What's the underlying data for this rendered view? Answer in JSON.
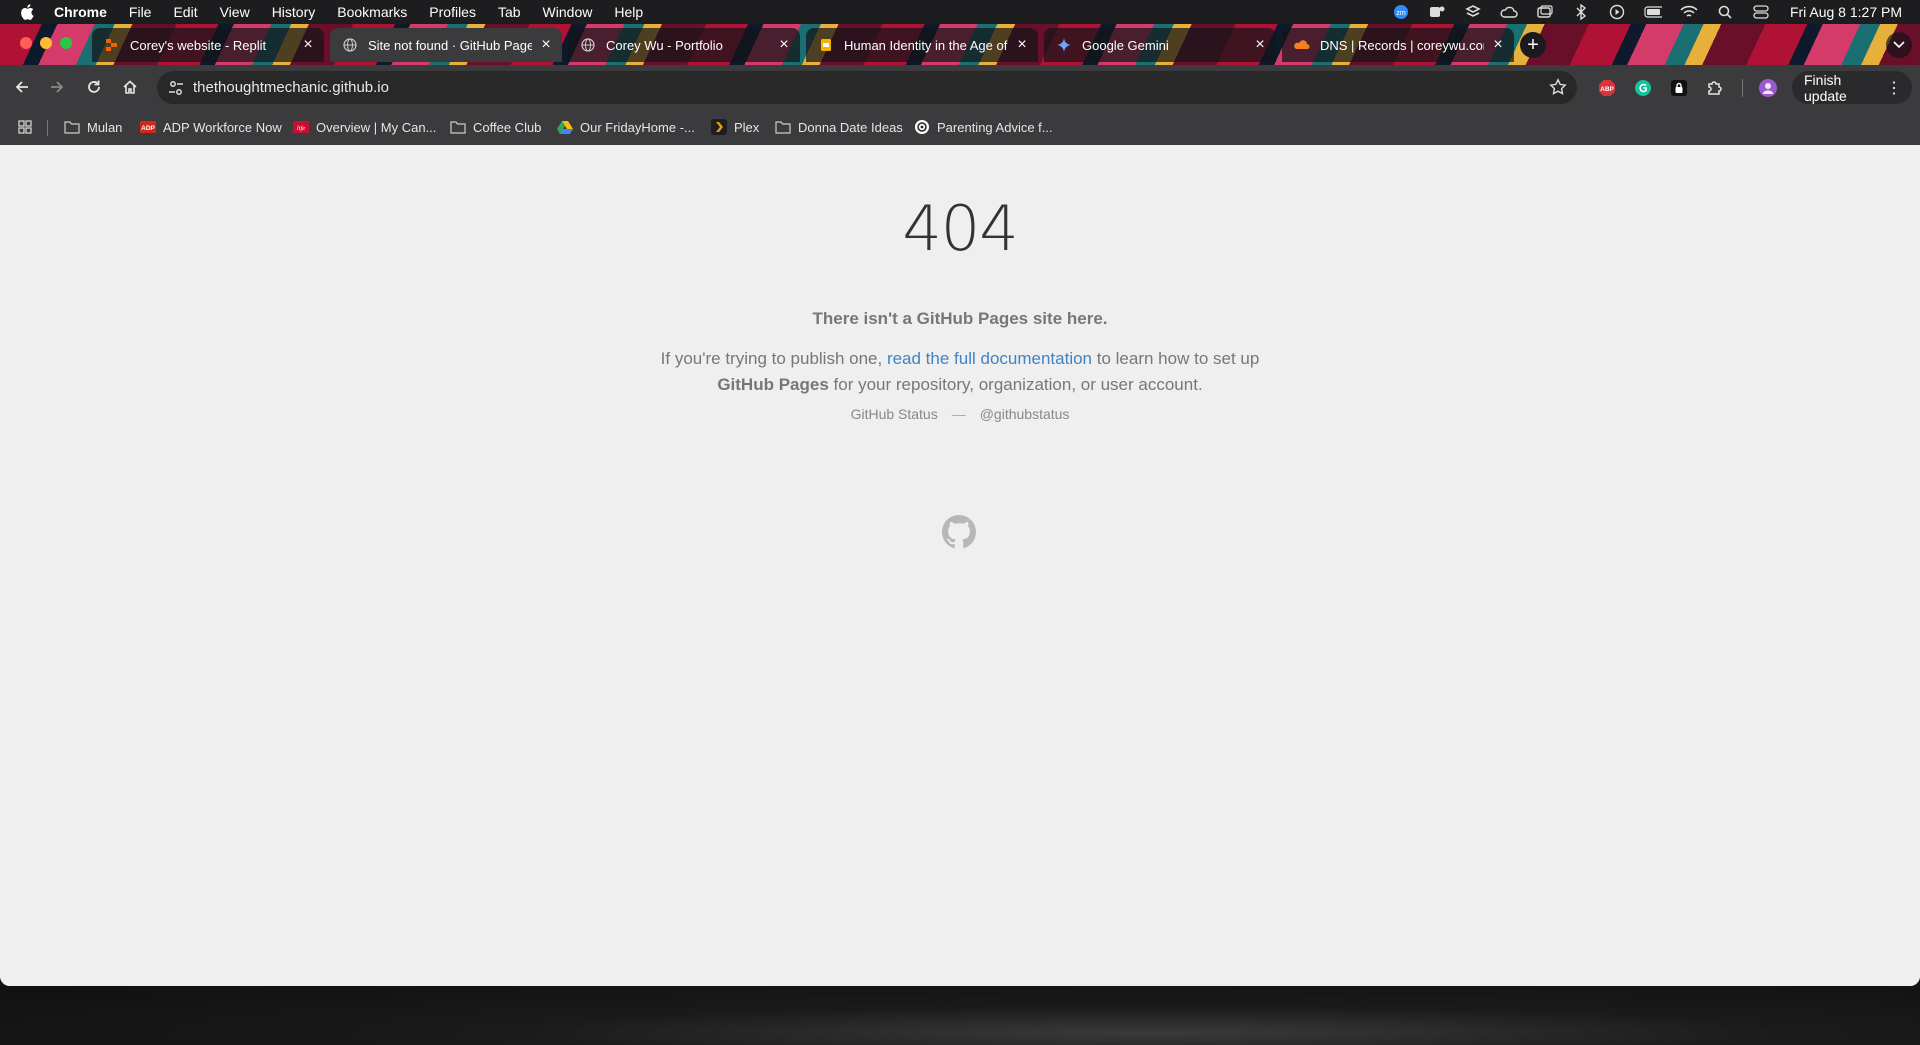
{
  "menubar": {
    "app": "Chrome",
    "items": [
      "File",
      "Edit",
      "View",
      "History",
      "Bookmarks",
      "Profiles",
      "Tab",
      "Window",
      "Help"
    ],
    "clock": "Fri Aug 8  1:27 PM"
  },
  "tabs": [
    {
      "title": "Corey's website - Replit",
      "icon": "replit-icon",
      "active": false
    },
    {
      "title": "Site not found · GitHub Pages",
      "icon": "globe-icon",
      "active": true
    },
    {
      "title": "Corey Wu - Portfolio",
      "icon": "globe-icon",
      "active": false
    },
    {
      "title": "Human Identity in the Age of",
      "icon": "slides-icon",
      "active": false
    },
    {
      "title": "Google Gemini",
      "icon": "gemini-icon",
      "active": false
    },
    {
      "title": "DNS | Records | coreywu.com",
      "icon": "cloudflare-icon",
      "active": false
    }
  ],
  "toolbar": {
    "url": "thethoughtmechanic.github.io",
    "finish_update": "Finish update"
  },
  "bookmarks": [
    {
      "label": "Mulan",
      "icon": "folder-icon"
    },
    {
      "label": "ADP Workforce Now",
      "icon": "adp-icon"
    },
    {
      "label": "Overview | My Can...",
      "icon": "life-icon"
    },
    {
      "label": "Coffee Club",
      "icon": "folder-icon"
    },
    {
      "label": "Our FridayHome -...",
      "icon": "drive-icon"
    },
    {
      "label": "Plex",
      "icon": "plex-icon"
    },
    {
      "label": "Donna Date Ideas",
      "icon": "folder-icon"
    },
    {
      "label": "Parenting Advice f...",
      "icon": "openai-icon"
    }
  ],
  "page": {
    "code": "404",
    "lead": "There isn't a GitHub Pages site here.",
    "para_prefix": "If you're trying to publish one, ",
    "para_link": "read the full documentation",
    "para_mid": " to learn how to set up ",
    "para_strong": "GitHub Pages",
    "para_suffix": " for your repository, organization, or user account.",
    "status_link": "GitHub Status",
    "status_sep": "—",
    "twitter_link": "@githubstatus"
  },
  "colors": {
    "link": "#4183c4",
    "page_bg": "#efefef",
    "toolbar_bg": "#3b3b3d"
  }
}
